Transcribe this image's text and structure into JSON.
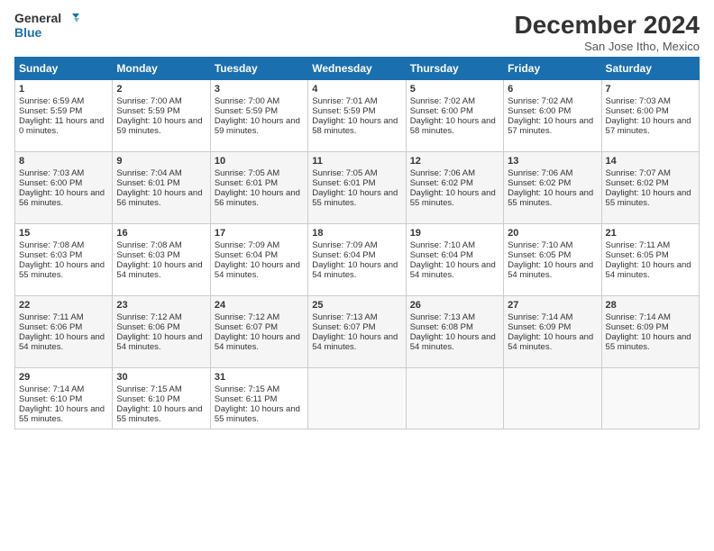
{
  "header": {
    "logo_line1": "General",
    "logo_line2": "Blue",
    "title": "December 2024",
    "location": "San Jose Itho, Mexico"
  },
  "days_of_week": [
    "Sunday",
    "Monday",
    "Tuesday",
    "Wednesday",
    "Thursday",
    "Friday",
    "Saturday"
  ],
  "weeks": [
    [
      {
        "day": "1",
        "sunrise": "6:59 AM",
        "sunset": "5:59 PM",
        "daylight": "11 hours and 0 minutes."
      },
      {
        "day": "2",
        "sunrise": "7:00 AM",
        "sunset": "5:59 PM",
        "daylight": "10 hours and 59 minutes."
      },
      {
        "day": "3",
        "sunrise": "7:00 AM",
        "sunset": "5:59 PM",
        "daylight": "10 hours and 59 minutes."
      },
      {
        "day": "4",
        "sunrise": "7:01 AM",
        "sunset": "5:59 PM",
        "daylight": "10 hours and 58 minutes."
      },
      {
        "day": "5",
        "sunrise": "7:02 AM",
        "sunset": "6:00 PM",
        "daylight": "10 hours and 58 minutes."
      },
      {
        "day": "6",
        "sunrise": "7:02 AM",
        "sunset": "6:00 PM",
        "daylight": "10 hours and 57 minutes."
      },
      {
        "day": "7",
        "sunrise": "7:03 AM",
        "sunset": "6:00 PM",
        "daylight": "10 hours and 57 minutes."
      }
    ],
    [
      {
        "day": "8",
        "sunrise": "7:03 AM",
        "sunset": "6:00 PM",
        "daylight": "10 hours and 56 minutes."
      },
      {
        "day": "9",
        "sunrise": "7:04 AM",
        "sunset": "6:01 PM",
        "daylight": "10 hours and 56 minutes."
      },
      {
        "day": "10",
        "sunrise": "7:05 AM",
        "sunset": "6:01 PM",
        "daylight": "10 hours and 56 minutes."
      },
      {
        "day": "11",
        "sunrise": "7:05 AM",
        "sunset": "6:01 PM",
        "daylight": "10 hours and 55 minutes."
      },
      {
        "day": "12",
        "sunrise": "7:06 AM",
        "sunset": "6:02 PM",
        "daylight": "10 hours and 55 minutes."
      },
      {
        "day": "13",
        "sunrise": "7:06 AM",
        "sunset": "6:02 PM",
        "daylight": "10 hours and 55 minutes."
      },
      {
        "day": "14",
        "sunrise": "7:07 AM",
        "sunset": "6:02 PM",
        "daylight": "10 hours and 55 minutes."
      }
    ],
    [
      {
        "day": "15",
        "sunrise": "7:08 AM",
        "sunset": "6:03 PM",
        "daylight": "10 hours and 55 minutes."
      },
      {
        "day": "16",
        "sunrise": "7:08 AM",
        "sunset": "6:03 PM",
        "daylight": "10 hours and 54 minutes."
      },
      {
        "day": "17",
        "sunrise": "7:09 AM",
        "sunset": "6:04 PM",
        "daylight": "10 hours and 54 minutes."
      },
      {
        "day": "18",
        "sunrise": "7:09 AM",
        "sunset": "6:04 PM",
        "daylight": "10 hours and 54 minutes."
      },
      {
        "day": "19",
        "sunrise": "7:10 AM",
        "sunset": "6:04 PM",
        "daylight": "10 hours and 54 minutes."
      },
      {
        "day": "20",
        "sunrise": "7:10 AM",
        "sunset": "6:05 PM",
        "daylight": "10 hours and 54 minutes."
      },
      {
        "day": "21",
        "sunrise": "7:11 AM",
        "sunset": "6:05 PM",
        "daylight": "10 hours and 54 minutes."
      }
    ],
    [
      {
        "day": "22",
        "sunrise": "7:11 AM",
        "sunset": "6:06 PM",
        "daylight": "10 hours and 54 minutes."
      },
      {
        "day": "23",
        "sunrise": "7:12 AM",
        "sunset": "6:06 PM",
        "daylight": "10 hours and 54 minutes."
      },
      {
        "day": "24",
        "sunrise": "7:12 AM",
        "sunset": "6:07 PM",
        "daylight": "10 hours and 54 minutes."
      },
      {
        "day": "25",
        "sunrise": "7:13 AM",
        "sunset": "6:07 PM",
        "daylight": "10 hours and 54 minutes."
      },
      {
        "day": "26",
        "sunrise": "7:13 AM",
        "sunset": "6:08 PM",
        "daylight": "10 hours and 54 minutes."
      },
      {
        "day": "27",
        "sunrise": "7:14 AM",
        "sunset": "6:09 PM",
        "daylight": "10 hours and 54 minutes."
      },
      {
        "day": "28",
        "sunrise": "7:14 AM",
        "sunset": "6:09 PM",
        "daylight": "10 hours and 55 minutes."
      }
    ],
    [
      {
        "day": "29",
        "sunrise": "7:14 AM",
        "sunset": "6:10 PM",
        "daylight": "10 hours and 55 minutes."
      },
      {
        "day": "30",
        "sunrise": "7:15 AM",
        "sunset": "6:10 PM",
        "daylight": "10 hours and 55 minutes."
      },
      {
        "day": "31",
        "sunrise": "7:15 AM",
        "sunset": "6:11 PM",
        "daylight": "10 hours and 55 minutes."
      },
      null,
      null,
      null,
      null
    ]
  ]
}
